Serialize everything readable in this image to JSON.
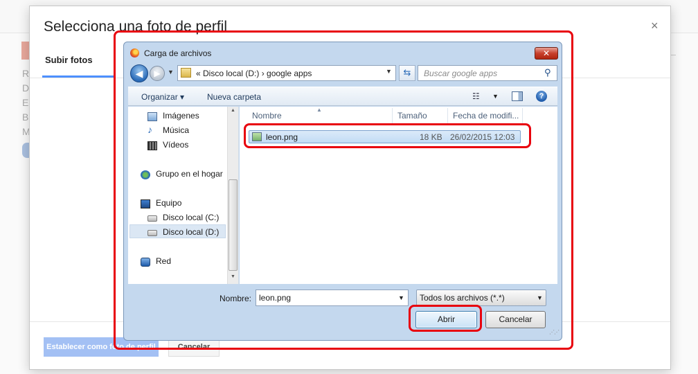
{
  "google_modal": {
    "title": "Selecciona una foto de perfil",
    "close": "×",
    "tab": "Subir fotos",
    "set_button": "Establecer como foto de perfil",
    "cancel_button": "Cancelar"
  },
  "file_dialog": {
    "title": "Carga de archivos",
    "close": "✕",
    "address": {
      "path": "«  Disco local (D:)  ›  google apps"
    },
    "search_placeholder": "Buscar google apps",
    "toolbar": {
      "organize": "Organizar ▾",
      "new_folder": "Nueva carpeta"
    },
    "nav_pane": {
      "items": [
        {
          "label": "Imágenes",
          "icon": "pictures-icon"
        },
        {
          "label": "Música",
          "icon": "music-icon"
        },
        {
          "label": "Vídeos",
          "icon": "videos-icon"
        },
        {
          "label": "Grupo en el hogar",
          "icon": "homegroup-icon"
        },
        {
          "label": "Equipo",
          "icon": "computer-icon"
        },
        {
          "label": "Disco local (C:)",
          "icon": "drive-icon"
        },
        {
          "label": "Disco local (D:)",
          "icon": "drive-icon",
          "selected": true
        },
        {
          "label": "Red",
          "icon": "network-icon"
        }
      ]
    },
    "columns": [
      "Nombre",
      "Tamaño",
      "Fecha de modifi..."
    ],
    "files": [
      {
        "name": "leon.png",
        "size": "18 KB",
        "date": "26/02/2015 12:03",
        "selected": true
      }
    ],
    "filename_label": "Nombre:",
    "filename_value": "leon.png",
    "filetype_value": "Todos los archivos (*.*)",
    "open_button": "Abrir",
    "cancel_button": "Cancelar"
  },
  "background_page": {
    "sidebar_letters": [
      "R",
      "D",
      "E",
      "B",
      "M"
    ]
  },
  "colors": {
    "highlight": "#e8000d",
    "google_blue": "#4d90fe",
    "primary_disabled": "#a3c0f4"
  }
}
